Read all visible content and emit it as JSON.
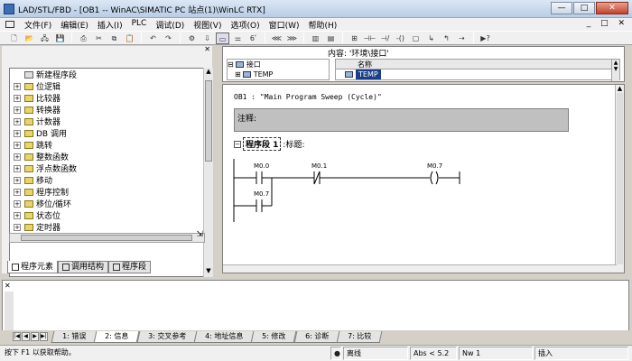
{
  "window": {
    "title": "LAD/STL/FBD  - [OB1 -- WinAC\\SIMATIC PC 站点(1)\\WinLC RTX]",
    "buttons": {
      "minimize": "—",
      "maximize": "□",
      "close": "✕"
    }
  },
  "menu": {
    "items": [
      "文件(F)",
      "编辑(E)",
      "插入(I)",
      "PLC",
      "调试(D)",
      "视图(V)",
      "选项(O)",
      "窗口(W)",
      "帮助(H)"
    ],
    "mdi_controls": "_ □ ✕"
  },
  "toolbar": {
    "buttons": [
      {
        "icon": "new-icon",
        "glyph": "🗋"
      },
      {
        "icon": "open-icon",
        "glyph": "📂"
      },
      {
        "icon": "open-online-icon",
        "glyph": "🖧"
      },
      {
        "icon": "save-icon",
        "glyph": "💾"
      },
      {
        "icon": "print-icon",
        "glyph": "⎙"
      },
      {
        "icon": "cut-icon",
        "glyph": "✂"
      },
      {
        "icon": "copy-icon",
        "glyph": "⧉"
      },
      {
        "icon": "paste-icon",
        "glyph": "📋"
      },
      {
        "icon": "undo-icon",
        "glyph": "↶"
      },
      {
        "icon": "redo-icon",
        "glyph": "↷"
      },
      {
        "icon": "online-icon",
        "glyph": "⚙"
      },
      {
        "icon": "download-icon",
        "glyph": "⇩"
      },
      {
        "icon": "overview-icon",
        "glyph": "▭"
      },
      {
        "icon": "network-icon",
        "glyph": "⚌"
      },
      {
        "icon": "monitor-icon",
        "glyph": "6ʹ"
      },
      {
        "icon": "nav-left-icon",
        "glyph": "⋘"
      },
      {
        "icon": "nav-right-icon",
        "glyph": "⋙"
      },
      {
        "icon": "view-detail-icon",
        "glyph": "▥"
      },
      {
        "icon": "view-split-icon",
        "glyph": "▤"
      },
      {
        "icon": "insert-network-icon",
        "glyph": "⊞"
      },
      {
        "icon": "contact-no-icon",
        "glyph": "⊣⊢"
      },
      {
        "icon": "contact-nc-icon",
        "glyph": "⊣/⊢"
      },
      {
        "icon": "coil-icon",
        "glyph": "-()"
      },
      {
        "icon": "box-icon",
        "glyph": "▢"
      },
      {
        "icon": "branch-open-icon",
        "glyph": "↳"
      },
      {
        "icon": "branch-close-icon",
        "glyph": "↰"
      },
      {
        "icon": "link-icon",
        "glyph": "⇢"
      },
      {
        "icon": "help-icon",
        "glyph": "▶?"
      }
    ]
  },
  "left_panel": {
    "tree_items": [
      {
        "label": "新建程序段",
        "expand": "",
        "icon": "new-network-icon"
      },
      {
        "label": "位逻辑",
        "expand": "+",
        "icon": "folder-icon"
      },
      {
        "label": "比较器",
        "expand": "+",
        "icon": "folder-icon"
      },
      {
        "label": "转换器",
        "expand": "+",
        "icon": "folder-icon"
      },
      {
        "label": "计数器",
        "expand": "+",
        "icon": "folder-icon"
      },
      {
        "label": "DB 调用",
        "expand": "+",
        "icon": "folder-icon"
      },
      {
        "label": "跳转",
        "expand": "+",
        "icon": "folder-icon"
      },
      {
        "label": "整数函数",
        "expand": "+",
        "icon": "folder-icon"
      },
      {
        "label": "浮点数函数",
        "expand": "+",
        "icon": "folder-icon"
      },
      {
        "label": "移动",
        "expand": "+",
        "icon": "folder-icon"
      },
      {
        "label": "程序控制",
        "expand": "+",
        "icon": "folder-icon"
      },
      {
        "label": "移位/循环",
        "expand": "+",
        "icon": "folder-icon"
      },
      {
        "label": "状态位",
        "expand": "+",
        "icon": "folder-icon"
      },
      {
        "label": "定时器",
        "expand": "+",
        "icon": "folder-icon"
      }
    ],
    "tabs": [
      {
        "label": "程序元素",
        "active": true
      },
      {
        "label": "调用结构",
        "active": false
      },
      {
        "label": "程序段",
        "active": false
      }
    ]
  },
  "interface": {
    "context_label": "内容: '环境\\接口'",
    "tree": [
      {
        "expand": "⊟",
        "label": "接口"
      },
      {
        "expand": "⊞",
        "label": "TEMP"
      }
    ],
    "table_header": "名称",
    "table_rows": [
      {
        "name": "TEMP",
        "selected": true
      }
    ]
  },
  "editor": {
    "block_header": "OB1 :  \"Main Program Sweep (Cycle)\"",
    "comment_label": "注释:",
    "network_label": "程序段 1",
    "network_title": ":标题:",
    "ladder": {
      "contact1": "M0.0",
      "contact2": "M0.1",
      "coil": "M0.7",
      "parallel_contact": "M0.7"
    }
  },
  "output": {
    "nav_buttons": [
      "|◀",
      "◀",
      "▶",
      "▶|"
    ],
    "tabs": [
      {
        "label": "1: 错误",
        "active": false
      },
      {
        "label": "2: 信息",
        "active": true
      },
      {
        "label": "3: 交叉参考",
        "active": false
      },
      {
        "label": "4: 地址信息",
        "active": false
      },
      {
        "label": "5: 修改",
        "active": false
      },
      {
        "label": "6: 诊断",
        "active": false
      },
      {
        "label": "7: 比较",
        "active": false
      }
    ]
  },
  "statusbar": {
    "help": "按下 F1 以获取帮助。",
    "mode_icon": "●",
    "online": "离线",
    "abs": "Abs < 5.2",
    "nw": "Nw 1",
    "insert": "插入"
  }
}
